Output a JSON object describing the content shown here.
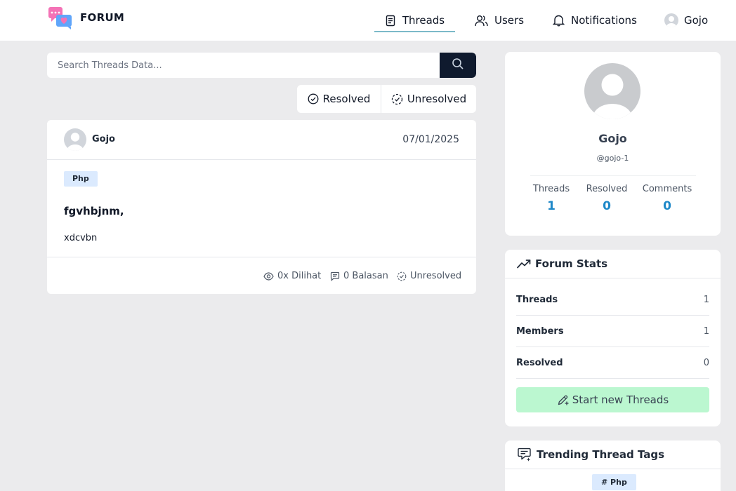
{
  "header": {
    "brand": "FORUM",
    "nav": [
      {
        "label": "Threads",
        "icon": "document-icon",
        "active": true
      },
      {
        "label": "Users",
        "icon": "users-icon"
      },
      {
        "label": "Notifications",
        "icon": "bell-icon"
      }
    ],
    "user": {
      "name": "Gojo",
      "icon": "avatar"
    }
  },
  "search": {
    "placeholder": "Search Threads Data...",
    "value": "",
    "button_icon": "search-icon"
  },
  "filters": [
    {
      "label": "Resolved",
      "icon": "check-circle-icon"
    },
    {
      "label": "Unresolved",
      "icon": "dashed-check-circle-icon"
    }
  ],
  "threads": [
    {
      "author": "Gojo",
      "date": "07/01/2025",
      "tag": "Php",
      "title": "fgvhbjnm,",
      "body": "xdcvbn",
      "views": "0x Dilihat",
      "replies": "0 Balasan",
      "status": "Unresolved"
    }
  ],
  "profile": {
    "name": "Gojo",
    "handle": "@gojo-1",
    "stats": [
      {
        "label": "Threads",
        "value": "1"
      },
      {
        "label": "Resolved",
        "value": "0"
      },
      {
        "label": "Comments",
        "value": "0"
      }
    ]
  },
  "forum_stats": {
    "title": "Forum Stats",
    "rows": [
      {
        "label": "Threads",
        "value": "1"
      },
      {
        "label": "Members",
        "value": "1"
      },
      {
        "label": "Resolved",
        "value": "0"
      }
    ],
    "button": "Start new Threads"
  },
  "trending": {
    "title": "Trending Thread Tags",
    "tags": [
      "# Php"
    ]
  },
  "colors": {
    "accent_dark": "#0f1a2e",
    "stat_value": "#1e88c8",
    "tag_bg": "#dbeafe",
    "new_button_bg": "#bbf7d0",
    "nav_underline": "#7cb9c9"
  }
}
